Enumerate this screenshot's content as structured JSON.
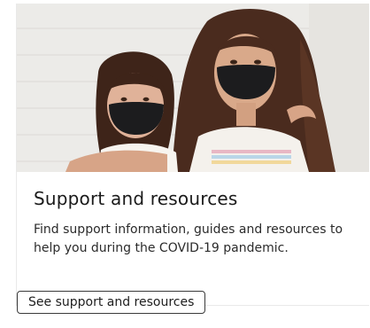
{
  "card": {
    "image_alt": "Two children wearing black face masks",
    "title": "Support and resources",
    "description": "Find support information, guides and resources to help you during the COVID-19 pandemic.",
    "cta_label": "See support and resources"
  }
}
